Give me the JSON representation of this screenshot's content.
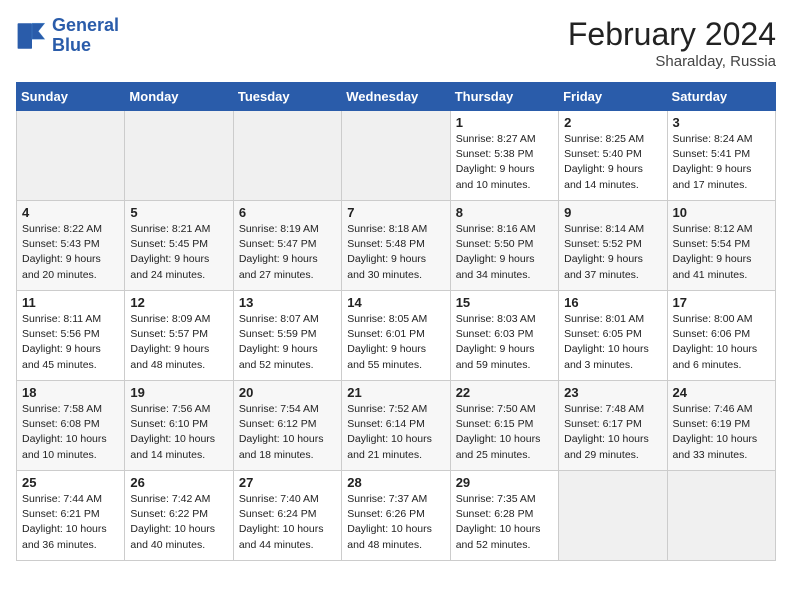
{
  "header": {
    "logo_line1": "General",
    "logo_line2": "Blue",
    "month_year": "February 2024",
    "location": "Sharalday, Russia"
  },
  "weekdays": [
    "Sunday",
    "Monday",
    "Tuesday",
    "Wednesday",
    "Thursday",
    "Friday",
    "Saturday"
  ],
  "weeks": [
    [
      {
        "day": "",
        "info": ""
      },
      {
        "day": "",
        "info": ""
      },
      {
        "day": "",
        "info": ""
      },
      {
        "day": "",
        "info": ""
      },
      {
        "day": "1",
        "info": "Sunrise: 8:27 AM\nSunset: 5:38 PM\nDaylight: 9 hours\nand 10 minutes."
      },
      {
        "day": "2",
        "info": "Sunrise: 8:25 AM\nSunset: 5:40 PM\nDaylight: 9 hours\nand 14 minutes."
      },
      {
        "day": "3",
        "info": "Sunrise: 8:24 AM\nSunset: 5:41 PM\nDaylight: 9 hours\nand 17 minutes."
      }
    ],
    [
      {
        "day": "4",
        "info": "Sunrise: 8:22 AM\nSunset: 5:43 PM\nDaylight: 9 hours\nand 20 minutes."
      },
      {
        "day": "5",
        "info": "Sunrise: 8:21 AM\nSunset: 5:45 PM\nDaylight: 9 hours\nand 24 minutes."
      },
      {
        "day": "6",
        "info": "Sunrise: 8:19 AM\nSunset: 5:47 PM\nDaylight: 9 hours\nand 27 minutes."
      },
      {
        "day": "7",
        "info": "Sunrise: 8:18 AM\nSunset: 5:48 PM\nDaylight: 9 hours\nand 30 minutes."
      },
      {
        "day": "8",
        "info": "Sunrise: 8:16 AM\nSunset: 5:50 PM\nDaylight: 9 hours\nand 34 minutes."
      },
      {
        "day": "9",
        "info": "Sunrise: 8:14 AM\nSunset: 5:52 PM\nDaylight: 9 hours\nand 37 minutes."
      },
      {
        "day": "10",
        "info": "Sunrise: 8:12 AM\nSunset: 5:54 PM\nDaylight: 9 hours\nand 41 minutes."
      }
    ],
    [
      {
        "day": "11",
        "info": "Sunrise: 8:11 AM\nSunset: 5:56 PM\nDaylight: 9 hours\nand 45 minutes."
      },
      {
        "day": "12",
        "info": "Sunrise: 8:09 AM\nSunset: 5:57 PM\nDaylight: 9 hours\nand 48 minutes."
      },
      {
        "day": "13",
        "info": "Sunrise: 8:07 AM\nSunset: 5:59 PM\nDaylight: 9 hours\nand 52 minutes."
      },
      {
        "day": "14",
        "info": "Sunrise: 8:05 AM\nSunset: 6:01 PM\nDaylight: 9 hours\nand 55 minutes."
      },
      {
        "day": "15",
        "info": "Sunrise: 8:03 AM\nSunset: 6:03 PM\nDaylight: 9 hours\nand 59 minutes."
      },
      {
        "day": "16",
        "info": "Sunrise: 8:01 AM\nSunset: 6:05 PM\nDaylight: 10 hours\nand 3 minutes."
      },
      {
        "day": "17",
        "info": "Sunrise: 8:00 AM\nSunset: 6:06 PM\nDaylight: 10 hours\nand 6 minutes."
      }
    ],
    [
      {
        "day": "18",
        "info": "Sunrise: 7:58 AM\nSunset: 6:08 PM\nDaylight: 10 hours\nand 10 minutes."
      },
      {
        "day": "19",
        "info": "Sunrise: 7:56 AM\nSunset: 6:10 PM\nDaylight: 10 hours\nand 14 minutes."
      },
      {
        "day": "20",
        "info": "Sunrise: 7:54 AM\nSunset: 6:12 PM\nDaylight: 10 hours\nand 18 minutes."
      },
      {
        "day": "21",
        "info": "Sunrise: 7:52 AM\nSunset: 6:14 PM\nDaylight: 10 hours\nand 21 minutes."
      },
      {
        "day": "22",
        "info": "Sunrise: 7:50 AM\nSunset: 6:15 PM\nDaylight: 10 hours\nand 25 minutes."
      },
      {
        "day": "23",
        "info": "Sunrise: 7:48 AM\nSunset: 6:17 PM\nDaylight: 10 hours\nand 29 minutes."
      },
      {
        "day": "24",
        "info": "Sunrise: 7:46 AM\nSunset: 6:19 PM\nDaylight: 10 hours\nand 33 minutes."
      }
    ],
    [
      {
        "day": "25",
        "info": "Sunrise: 7:44 AM\nSunset: 6:21 PM\nDaylight: 10 hours\nand 36 minutes."
      },
      {
        "day": "26",
        "info": "Sunrise: 7:42 AM\nSunset: 6:22 PM\nDaylight: 10 hours\nand 40 minutes."
      },
      {
        "day": "27",
        "info": "Sunrise: 7:40 AM\nSunset: 6:24 PM\nDaylight: 10 hours\nand 44 minutes."
      },
      {
        "day": "28",
        "info": "Sunrise: 7:37 AM\nSunset: 6:26 PM\nDaylight: 10 hours\nand 48 minutes."
      },
      {
        "day": "29",
        "info": "Sunrise: 7:35 AM\nSunset: 6:28 PM\nDaylight: 10 hours\nand 52 minutes."
      },
      {
        "day": "",
        "info": ""
      },
      {
        "day": "",
        "info": ""
      }
    ]
  ]
}
